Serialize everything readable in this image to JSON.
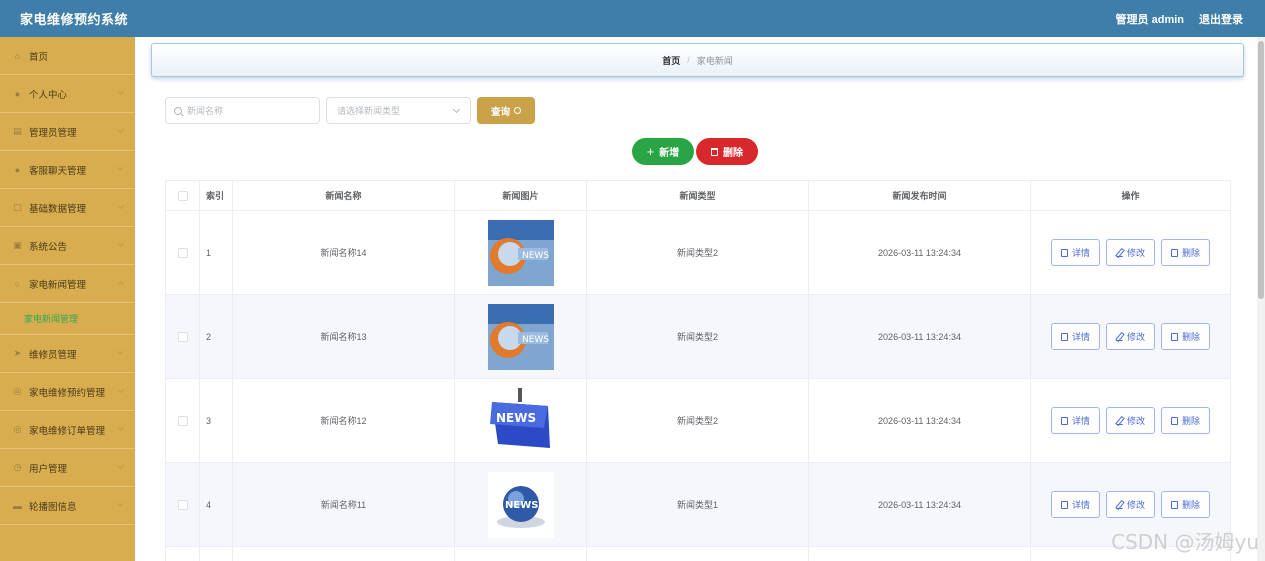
{
  "header": {
    "title": "家电维修预约系统",
    "user": "管理员 admin",
    "logout": "退出登录"
  },
  "sidebar": {
    "items": [
      {
        "label": "首页",
        "icon": "home-icon"
      },
      {
        "label": "个人中心",
        "icon": "user-icon"
      },
      {
        "label": "管理员管理",
        "icon": "admin-icon"
      },
      {
        "label": "客服聊天管理",
        "icon": "chat-icon"
      },
      {
        "label": "基础数据管理",
        "icon": "data-icon"
      },
      {
        "label": "系统公告",
        "icon": "notice-icon"
      },
      {
        "label": "家电新闻管理",
        "icon": "news-icon",
        "sub": "家电新闻管理"
      },
      {
        "label": "维修员管理",
        "icon": "repairman-icon"
      },
      {
        "label": "家电维修预约管理",
        "icon": "appointment-icon"
      },
      {
        "label": "家电维修订单管理",
        "icon": "order-icon"
      },
      {
        "label": "用户管理",
        "icon": "users-icon"
      },
      {
        "label": "轮播图信息",
        "icon": "carousel-icon"
      }
    ]
  },
  "breadcrumb": {
    "home": "首页",
    "separator": "/",
    "current": "家电新闻"
  },
  "search": {
    "name_placeholder": "新闻名称",
    "type_placeholder": "请选择新闻类型",
    "query_label": "查询"
  },
  "actions": {
    "add_label": "新增",
    "delete_label": "删除"
  },
  "table": {
    "headers": [
      "索引",
      "新闻名称",
      "新闻图片",
      "新闻类型",
      "新闻发布时间",
      "操作"
    ],
    "rows": [
      {
        "index": "1",
        "name": "新闻名称14",
        "image": "news-image-blue",
        "type": "新闻类型2",
        "time": "2026-03-11 13:24:34"
      },
      {
        "index": "2",
        "name": "新闻名称13",
        "image": "news-image-blue",
        "type": "新闻类型2",
        "time": "2026-03-11 13:24:34"
      },
      {
        "index": "3",
        "name": "新闻名称12",
        "image": "news-image-key",
        "type": "新闻类型2",
        "time": "2026-03-11 13:24:34"
      },
      {
        "index": "4",
        "name": "新闻名称11",
        "image": "news-image-globe",
        "type": "新闻类型1",
        "time": "2026-03-11 13:24:34"
      }
    ],
    "op_labels": {
      "detail": "详情",
      "edit": "修改",
      "delete": "删除"
    }
  },
  "watermark": "CSDN @汤姆yu",
  "colors": {
    "header": "#3f7ea8",
    "sidebar": "#d7ad4f",
    "add": "#2aa545",
    "delete": "#d8282b",
    "query": "#c9a24a",
    "active_sub": "#2faa56"
  }
}
